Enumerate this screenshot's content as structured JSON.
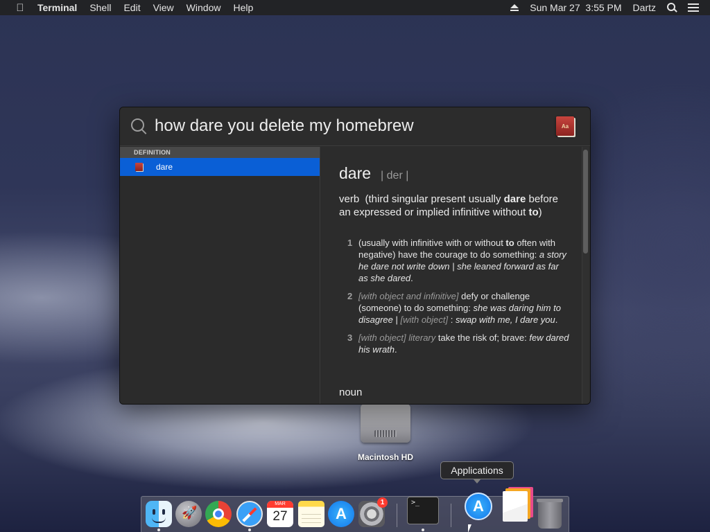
{
  "menubar": {
    "apple_icon": "apple-logo",
    "app_name": "Terminal",
    "items": [
      "Shell",
      "Edit",
      "View",
      "Window",
      "Help"
    ],
    "datetime": "Sun Mar 27  3:55 PM",
    "user": "Dartz",
    "status_icons": [
      "eject-icon",
      "spotlight-search-icon",
      "notification-center-icon"
    ]
  },
  "desktop": {
    "disk_label": "Macintosh HD"
  },
  "spotlight": {
    "query": "how dare you delete my homebrew",
    "section_header": "DEFINITION",
    "results": [
      {
        "label": "dare",
        "icon": "dictionary-icon",
        "selected": true
      }
    ],
    "preview": {
      "headword": "dare",
      "pronunciation": "| der |",
      "pos_intro": {
        "pos": "verb",
        "p1": "  (third singular present usually ",
        "b1": "dare",
        "p2": " before an expressed or implied infinitive without ",
        "b2": "to",
        "p3": ")"
      },
      "senses": [
        {
          "num": "1",
          "a": "(usually with infinitive with or without ",
          "b": "to",
          "c": " often with negative) have the courage to do something: ",
          "ex": "a story he dare not write down | she leaned forward as far as she dared",
          "end": "."
        },
        {
          "num": "2",
          "gram1": "[with object and infinitive]",
          "a": " defy or challenge (someone) to do something: ",
          "ex1": "she was daring him to disagree",
          "sep": " | ",
          "gram2": "[with object]",
          "colon": " : ",
          "ex2": "swap with me, I dare you",
          "end": "."
        },
        {
          "num": "3",
          "gram1": "[with object] literary",
          "a": " take the risk of; brave: ",
          "ex": "few dared his wrath",
          "end": "."
        }
      ],
      "next_pos": "noun"
    }
  },
  "tooltip": "Applications",
  "dock": {
    "apps": [
      "Finder",
      "Launchpad",
      "Google Chrome",
      "Safari",
      "Calendar",
      "Notes",
      "App Store",
      "System Preferences",
      "Terminal",
      "Applications",
      "Documents",
      "Trash"
    ],
    "calendar_month": "MAR",
    "calendar_day": "27",
    "sysprefs_badge": "1",
    "terminal_prompt": ">_"
  },
  "colors": {
    "selection": "#0a5fd6",
    "badge": "#ff3b30",
    "menubar": "#222224"
  }
}
